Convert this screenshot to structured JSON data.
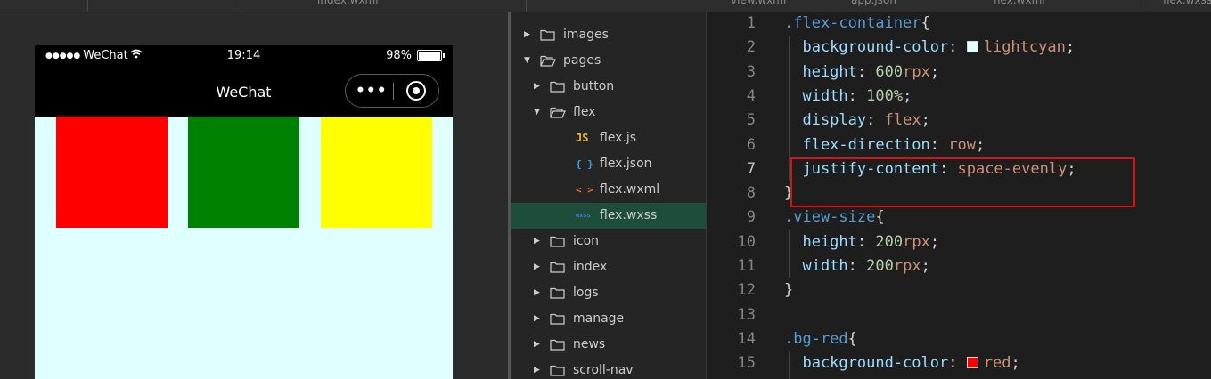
{
  "top_tabs": [
    {
      "label": "index.wxml"
    },
    {
      "label": "view.wxml"
    },
    {
      "label": "app.json"
    },
    {
      "label": "flex.wxml"
    },
    {
      "label": "flex.wxss"
    }
  ],
  "simulator": {
    "status_bar": {
      "signal": "●●●●●",
      "carrier": "WeChat",
      "time": "19:14",
      "battery_text": "98%",
      "battery_level": 0.98
    },
    "nav_title": "WeChat",
    "capsule": {
      "more": "•••"
    },
    "background_color": "#e0ffff",
    "boxes": [
      {
        "color": "#ff0000"
      },
      {
        "color": "#008000"
      },
      {
        "color": "#ffff00"
      }
    ]
  },
  "file_tree": {
    "items": [
      {
        "label": "images",
        "type": "folder",
        "expanded": false,
        "depth": 0
      },
      {
        "label": "pages",
        "type": "folder",
        "expanded": true,
        "depth": 0
      },
      {
        "label": "button",
        "type": "folder",
        "expanded": false,
        "depth": 1
      },
      {
        "label": "flex",
        "type": "folder",
        "expanded": true,
        "depth": 1
      },
      {
        "label": "flex.js",
        "type": "file",
        "icon_text": "JS",
        "icon_color": "#e8b53a",
        "depth": 2
      },
      {
        "label": "flex.json",
        "type": "file",
        "icon_text": "{ }",
        "icon_color": "#3aa0e8",
        "depth": 2
      },
      {
        "label": "flex.wxml",
        "type": "file",
        "icon_text": "< >",
        "icon_color": "#e8733a",
        "depth": 2
      },
      {
        "label": "flex.wxss",
        "type": "file",
        "icon_text": "wxss",
        "icon_color": "#3a7be8",
        "depth": 2,
        "selected": true
      },
      {
        "label": "icon",
        "type": "folder",
        "expanded": false,
        "depth": 1
      },
      {
        "label": "index",
        "type": "folder",
        "expanded": false,
        "depth": 1
      },
      {
        "label": "logs",
        "type": "folder",
        "expanded": false,
        "depth": 1
      },
      {
        "label": "manage",
        "type": "folder",
        "expanded": false,
        "depth": 1
      },
      {
        "label": "news",
        "type": "folder",
        "expanded": false,
        "depth": 1
      },
      {
        "label": "scroll-nav",
        "type": "folder",
        "expanded": false,
        "depth": 1
      }
    ]
  },
  "editor": {
    "active_line": 7,
    "lines": [
      {
        "n": "1",
        "tokens": [
          {
            "t": ".flex-container",
            "c": "sel"
          },
          {
            "t": "{",
            "c": "pun"
          }
        ]
      },
      {
        "n": "2",
        "tokens": [
          {
            "t": "  background-color",
            "c": "prop"
          },
          {
            "t": ": ",
            "c": "pun"
          },
          {
            "swatch": "#e0ffff"
          },
          {
            "t": "lightcyan",
            "c": "val"
          },
          {
            "t": ";",
            "c": "pun"
          }
        ]
      },
      {
        "n": "3",
        "tokens": [
          {
            "t": "  height",
            "c": "prop"
          },
          {
            "t": ": ",
            "c": "pun"
          },
          {
            "t": "600",
            "c": "num"
          },
          {
            "t": "rpx",
            "c": "val"
          },
          {
            "t": ";",
            "c": "pun"
          }
        ]
      },
      {
        "n": "4",
        "tokens": [
          {
            "t": "  width",
            "c": "prop"
          },
          {
            "t": ": ",
            "c": "pun"
          },
          {
            "t": "100%",
            "c": "num"
          },
          {
            "t": ";",
            "c": "pun"
          }
        ]
      },
      {
        "n": "5",
        "tokens": [
          {
            "t": "  display",
            "c": "prop"
          },
          {
            "t": ": ",
            "c": "pun"
          },
          {
            "t": "flex",
            "c": "val"
          },
          {
            "t": ";",
            "c": "pun"
          }
        ]
      },
      {
        "n": "6",
        "tokens": [
          {
            "t": "  flex-direction",
            "c": "prop"
          },
          {
            "t": ": ",
            "c": "pun"
          },
          {
            "t": "row",
            "c": "val"
          },
          {
            "t": ";",
            "c": "pun"
          }
        ]
      },
      {
        "n": "7",
        "tokens": [
          {
            "t": "  justify-content",
            "c": "prop"
          },
          {
            "t": ": ",
            "c": "pun"
          },
          {
            "t": "space-evenly",
            "c": "val"
          },
          {
            "t": ";",
            "c": "pun"
          }
        ]
      },
      {
        "n": "8",
        "tokens": [
          {
            "t": "}",
            "c": "pun"
          }
        ]
      },
      {
        "n": "9",
        "tokens": [
          {
            "t": ".view-size",
            "c": "sel"
          },
          {
            "t": "{",
            "c": "pun"
          }
        ]
      },
      {
        "n": "10",
        "tokens": [
          {
            "t": "  height",
            "c": "prop"
          },
          {
            "t": ": ",
            "c": "pun"
          },
          {
            "t": "200",
            "c": "num"
          },
          {
            "t": "rpx",
            "c": "val"
          },
          {
            "t": ";",
            "c": "pun"
          }
        ]
      },
      {
        "n": "11",
        "tokens": [
          {
            "t": "  width",
            "c": "prop"
          },
          {
            "t": ": ",
            "c": "pun"
          },
          {
            "t": "200",
            "c": "num"
          },
          {
            "t": "rpx",
            "c": "val"
          },
          {
            "t": ";",
            "c": "pun"
          }
        ]
      },
      {
        "n": "12",
        "tokens": [
          {
            "t": "}",
            "c": "pun"
          }
        ]
      },
      {
        "n": "13",
        "tokens": []
      },
      {
        "n": "14",
        "tokens": [
          {
            "t": ".bg-red",
            "c": "sel"
          },
          {
            "t": "{",
            "c": "pun"
          }
        ]
      },
      {
        "n": "15",
        "tokens": [
          {
            "t": "  background-color",
            "c": "prop"
          },
          {
            "t": ": ",
            "c": "pun"
          },
          {
            "swatch": "#ff0000"
          },
          {
            "t": "red",
            "c": "val"
          },
          {
            "t": ";",
            "c": "pun"
          }
        ]
      }
    ]
  }
}
